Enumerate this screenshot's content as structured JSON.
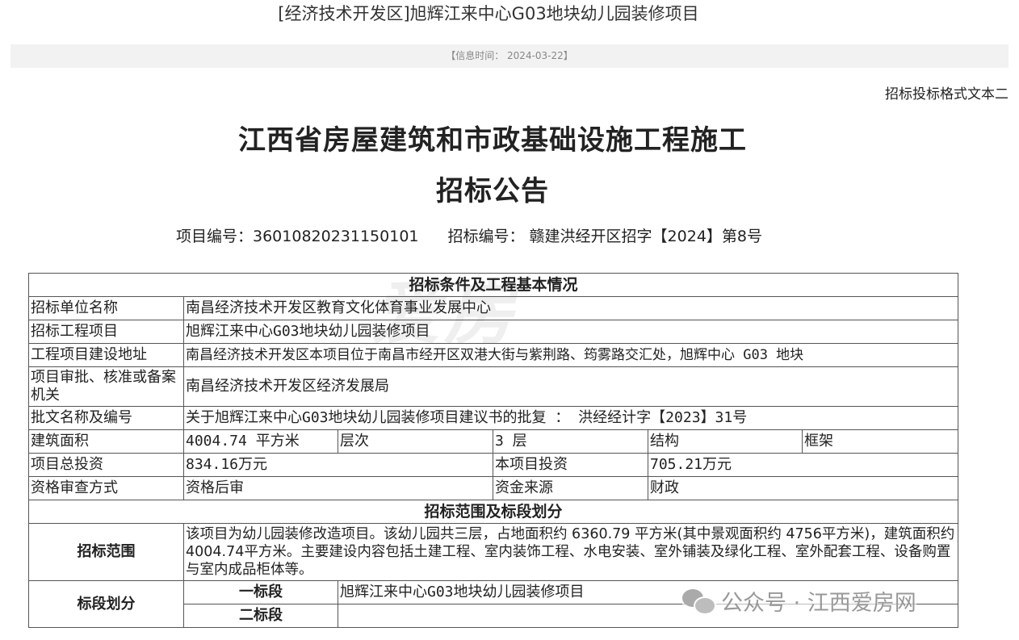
{
  "header": {
    "title": "[经济技术开发区]旭辉江来中心G03地块幼儿园装修项目",
    "info_time": "【信息时间： 2024-03-22】"
  },
  "doc": {
    "format_label": "招标投标格式文本二",
    "title_line1": "江西省房屋建筑和市政基础设施工程施工",
    "title_line2": "招标公告",
    "project_code": "项目编号：36010820231150101",
    "bid_code": "招标编号： 赣建洪经开区招字【2024】第8号"
  },
  "table": {
    "section1": "招标条件及工程基本情况",
    "rows": {
      "tenderer_label": "招标单位名称",
      "tenderer_value": "南昌经济技术开发区教育文化体育事业发展中心",
      "project_label": "招标工程项目",
      "project_value": "旭辉江来中心G03地块幼儿园装修项目",
      "address_label": "工程项目建设地址",
      "address_value": "南昌经济技术开发区本项目位于南昌市经开区双港大街与紫荆路、筠雾路交汇处，旭辉中心 G03 地块",
      "approval_label": "项目审批、核准或备案机关",
      "approval_value": "南昌经济技术开发区经济发展局",
      "doc_label": "批文名称及编号",
      "doc_value": "关于旭辉江来中心G03地块幼儿园装修项目建议书的批复 ： 洪经经计字【2023】31号",
      "area_label": "建筑面积",
      "area_value": "4004.74 平方米",
      "floors_label": "层次",
      "floors_value": "3 层",
      "structure_label": "结构",
      "structure_value": "框架",
      "total_inv_label": "项目总投资",
      "total_inv_value": "834.16万元",
      "this_inv_label": "本项目投资",
      "this_inv_value": "705.21万元",
      "qual_label": "资格审查方式",
      "qual_value": "资格后审",
      "fund_label": "资金来源",
      "fund_value": "财政"
    },
    "section2": "招标范围及标段划分",
    "scope_label": "招标范围",
    "scope_value": "该项目为幼儿园装修改造项目。该幼儿园共三层，占地面积约 6360.79 平方米(其中景观面积约 4756平方米)，建筑面积约 4004.74平方米。主要建设内容包括土建工程、室内装饰工程、水电安装、室外铺装及绿化工程、室外配套工程、设备购置与室内成品柜体等。",
    "section_label": "标段划分",
    "lot1_label": "一标段",
    "lot1_value": "旭辉江来中心G03地块幼儿园装修项目",
    "lot2_label": "二标段",
    "lot2_value": ""
  },
  "watermark": {
    "big_text": "爱房",
    "badge_text": "公众号 · 江西爱房网",
    "icon": "wechat-icon"
  }
}
